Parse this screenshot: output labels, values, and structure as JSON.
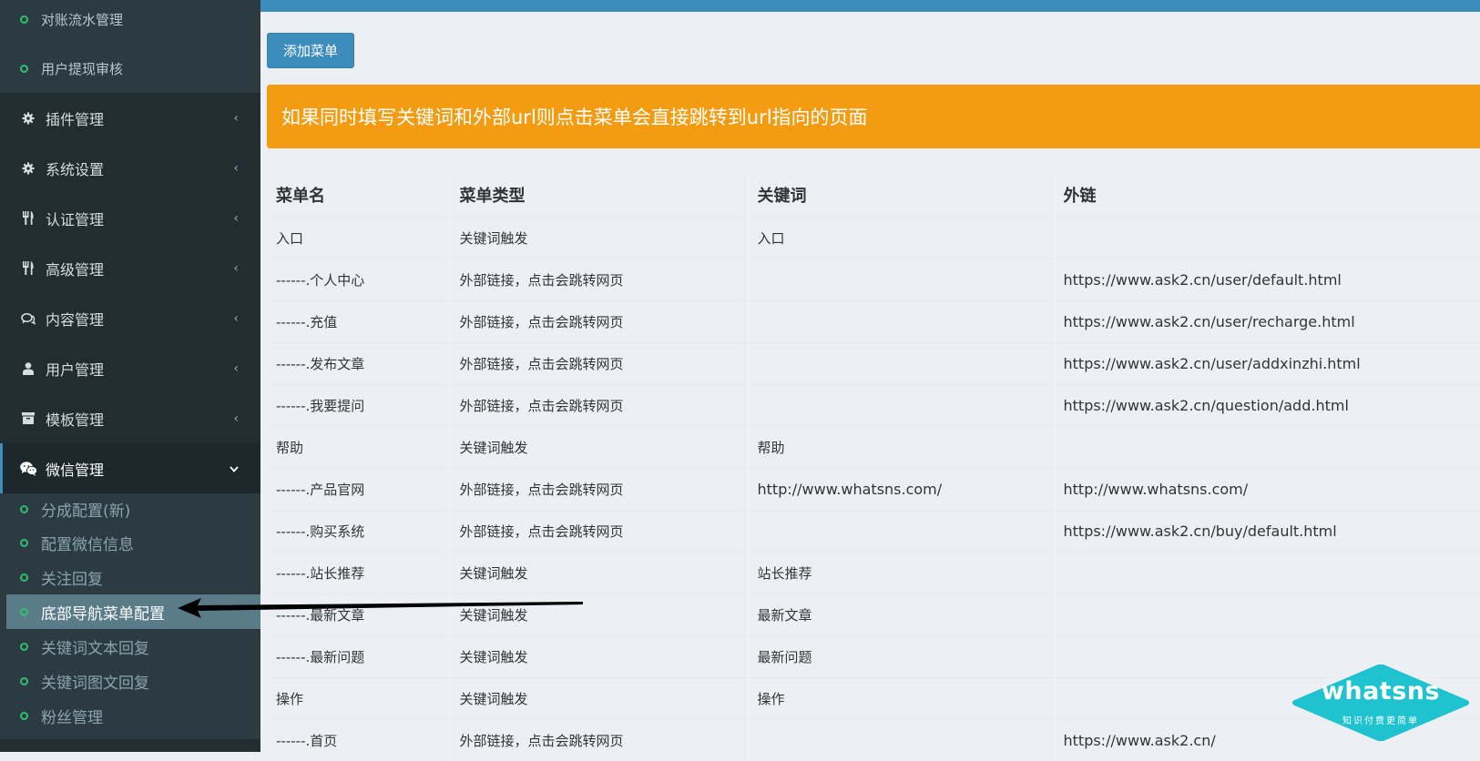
{
  "sidebar": {
    "top_subitems": [
      "对账流水管理",
      "用户提现审核"
    ],
    "menu": [
      {
        "label": "插件管理",
        "icon": "gear-icon"
      },
      {
        "label": "系统设置",
        "icon": "gear-icon"
      },
      {
        "label": "认证管理",
        "icon": "cutlery-icon"
      },
      {
        "label": "高级管理",
        "icon": "cutlery-icon"
      },
      {
        "label": "内容管理",
        "icon": "comments-icon"
      },
      {
        "label": "用户管理",
        "icon": "user-icon"
      },
      {
        "label": "模板管理",
        "icon": "archive-icon"
      },
      {
        "label": "微信管理",
        "icon": "wechat-icon"
      }
    ],
    "wechat_subitems": [
      "分成配置(新)",
      "配置微信信息",
      "关注回复",
      "底部导航菜单配置",
      "关键词文本回复",
      "关键词图文回复",
      "粉丝管理"
    ]
  },
  "toolbar": {
    "add_menu_label": "添加菜单"
  },
  "notice": {
    "text": "如果同时填写关键词和外部url则点击菜单会直接跳转到url指向的页面"
  },
  "table": {
    "headers": [
      "菜单名",
      "菜单类型",
      "关键词",
      "外链"
    ],
    "rows": [
      [
        "入口",
        "关键词触发",
        "入口",
        ""
      ],
      [
        "------.个人中心",
        "外部链接，点击会跳转网页",
        "",
        "https://www.ask2.cn/user/default.html"
      ],
      [
        "------.充值",
        "外部链接，点击会跳转网页",
        "",
        "https://www.ask2.cn/user/recharge.html"
      ],
      [
        "------.发布文章",
        "外部链接，点击会跳转网页",
        "",
        "https://www.ask2.cn/user/addxinzhi.html"
      ],
      [
        "------.我要提问",
        "外部链接，点击会跳转网页",
        "",
        "https://www.ask2.cn/question/add.html"
      ],
      [
        "帮助",
        "关键词触发",
        "帮助",
        ""
      ],
      [
        "------.产品官网",
        "外部链接，点击会跳转网页",
        "http://www.whatsns.com/",
        "http://www.whatsns.com/"
      ],
      [
        "------.购买系统",
        "外部链接，点击会跳转网页",
        "",
        "https://www.ask2.cn/buy/default.html"
      ],
      [
        "------.站长推荐",
        "关键词触发",
        "站长推荐",
        ""
      ],
      [
        "------.最新文章",
        "关键词触发",
        "最新文章",
        ""
      ],
      [
        "------.最新问题",
        "关键词触发",
        "最新问题",
        ""
      ],
      [
        "操作",
        "关键词触发",
        "操作",
        ""
      ],
      [
        "------.首页",
        "外部链接，点击会跳转网页",
        "",
        "https://www.ask2.cn/"
      ]
    ]
  },
  "watermark": {
    "brand": "whatsns",
    "slogan": "知识付费更简单"
  },
  "colors": {
    "sidebar_bg": "#222d32",
    "primary": "#3c8dbc",
    "warning": "#f39c12",
    "bullet": "#2fbf71"
  }
}
